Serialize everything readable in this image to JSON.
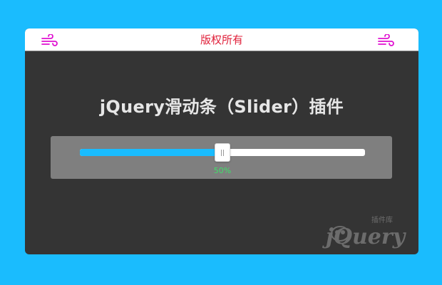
{
  "header": {
    "title": "版权所有",
    "left_icon": "wind-icon",
    "right_icon": "wind-icon",
    "icon_color": "#e010d0",
    "title_color": "#e0203a"
  },
  "main": {
    "heading": "jQuery滑动条（Slider）插件"
  },
  "slider": {
    "value": 50,
    "min": 0,
    "max": 100,
    "value_label": "50%",
    "fill_color": "#1ABCFE",
    "track_color": "#ffffff",
    "label_color": "#3fe06a"
  },
  "watermark": {
    "logo": "jquery-plugin-library-logo",
    "text": "jQuery",
    "subtext": "插件库"
  },
  "colors": {
    "page_background": "#1ABCFE",
    "card_background": "#343434",
    "panel_background": "#7f7f7f"
  }
}
